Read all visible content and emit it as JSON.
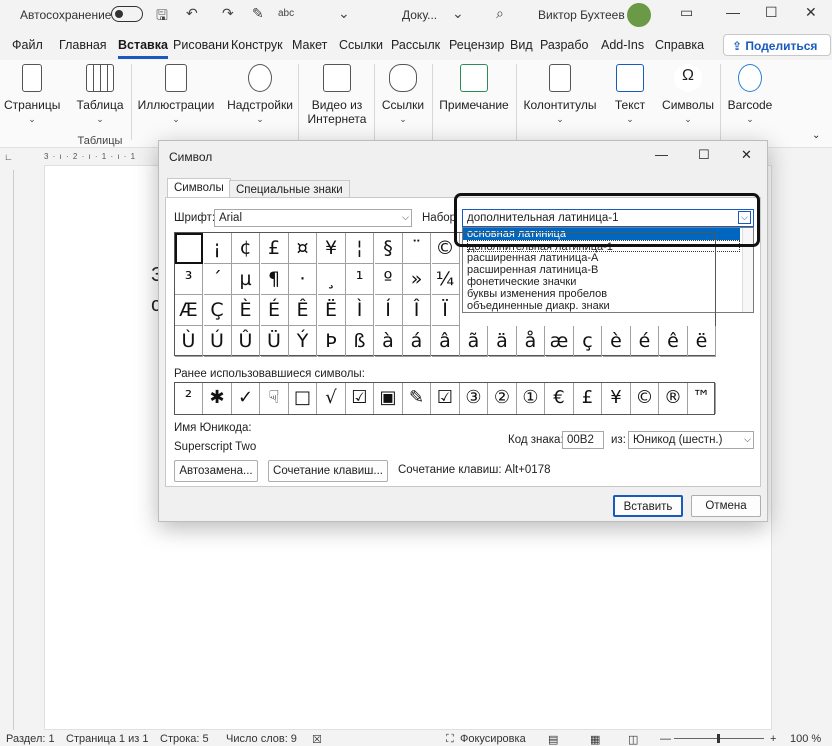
{
  "titlebar": {
    "autosave_label": "Автосохранение",
    "toggle_state": "Откл.",
    "doc_name": "Доку...",
    "user_name": "Виктор Бухтеев"
  },
  "tabs": [
    "Файл",
    "Главная",
    "Вставка",
    "Рисовани",
    "Конструк",
    "Макет",
    "Ссылки",
    "Рассылк",
    "Рецензир",
    "Вид",
    "Разрабо",
    "Add-Ins",
    "Справка"
  ],
  "share_label": "Поделиться",
  "ribbon": {
    "pages": "Страницы",
    "table": "Таблица",
    "tables_group": "Таблицы",
    "illustrations": "Иллюстрации",
    "addins": "Надстройки",
    "video": "Видео из Интернета",
    "links": "Ссылки",
    "comment": "Примечание",
    "headers": "Колонтитулы",
    "text": "Текст",
    "symbols": "Символы",
    "barcode": "Barcode"
  },
  "ruler": "3 · ı · 2 · ı · 1 · ı · 1",
  "doc": {
    "line1": "З",
    "line2": "с"
  },
  "dialog": {
    "title": "Символ",
    "tab_symbols": "Символы",
    "tab_special": "Специальные знаки",
    "font_label": "Шрифт:",
    "font_value": "Arial",
    "subset_label": "Набор",
    "subset_value": "дополнительная латиница-1",
    "subset_options": [
      "основная латиница",
      "дополнительная латиница-1",
      "расширенная латиница-A",
      "расширенная латиница-B",
      "фонетические значки",
      "буквы изменения пробелов",
      "объединенные диакр. знаки"
    ],
    "grid_rows": [
      [
        " ",
        "¡",
        "¢",
        "£",
        "¤",
        "¥",
        "¦",
        "§",
        "¨",
        "©"
      ],
      [
        "³",
        "´",
        "µ",
        "¶",
        "·",
        "¸",
        "¹",
        "º",
        "»",
        "¼"
      ],
      [
        "Æ",
        "Ç",
        "È",
        "É",
        "Ê",
        "Ë",
        "Ì",
        "Í",
        "Î",
        "Ï"
      ],
      [
        "Ù",
        "Ú",
        "Û",
        "Ü",
        "Ý",
        "Þ",
        "ß",
        "à",
        "á",
        "â",
        "ã",
        "ä",
        "å",
        "æ",
        "ç",
        "è",
        "é",
        "ê",
        "ë"
      ]
    ],
    "recent_label": "Ранее использовавшиеся символы:",
    "recent": [
      "²",
      "✱",
      "✓",
      "☟",
      "□",
      "√",
      "☑",
      "▣",
      "✎",
      "☑",
      "③",
      "②",
      "①",
      "€",
      "£",
      "¥",
      "©",
      "®",
      "™"
    ],
    "unicode_name_label": "Имя Юникода:",
    "unicode_name": "Superscript Two",
    "code_label": "Код знака:",
    "code_value": "00B2",
    "from_label": "из:",
    "from_value": "Юникод (шестн.)",
    "autocorrect": "Автозамена...",
    "shortcut_btn": "Сочетание клавиш...",
    "shortcut_text": "Сочетание клавиш: Alt+0178",
    "insert": "Вставить",
    "cancel": "Отмена"
  },
  "status": {
    "section": "Раздел: 1",
    "page": "Страница 1 из 1",
    "line": "Строка: 5",
    "words": "Число слов: 9",
    "focus": "Фокусировка",
    "zoom": "100 %"
  }
}
